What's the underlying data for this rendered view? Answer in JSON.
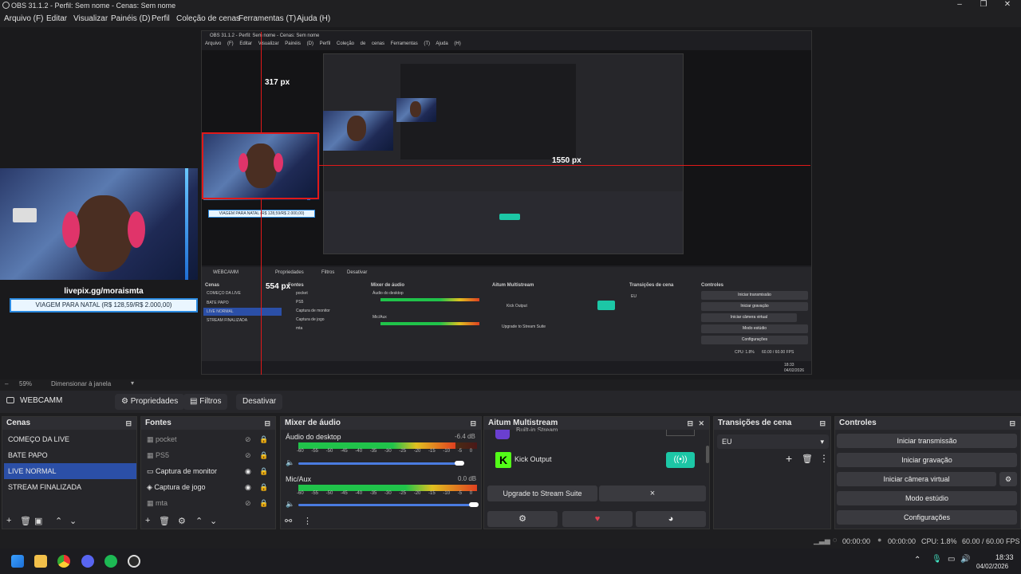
{
  "app": {
    "title": "OBS 31.1.2 - Perfil: Sem nome - Cenas: Sem nome"
  },
  "menu": [
    "Arquivo (F)",
    "Editar",
    "Visualizar",
    "Painéis (D)",
    "Perfil",
    "Coleção de cenas",
    "Ferramentas (T)",
    "Ajuda (H)"
  ],
  "preview": {
    "dim1": "317 px",
    "dim2": "554 px",
    "dim3": "1550 px",
    "overlay_url": "livepix.gg/moraismta",
    "overlay_goal": "VIAGEM PARA NATAL (R$ 128,59/R$ 2.000,00)",
    "zoom": "59%",
    "zoom_mode": "Dimensionar à janela"
  },
  "source_toolbar": {
    "source": "WEBCAMM",
    "properties": "Propriedades",
    "filters": "Filtros",
    "deactivate": "Desativar"
  },
  "scenes": {
    "title": "Cenas",
    "items": [
      "COMEÇO DA LIVE",
      "BATE PAPO",
      "LIVE NORMAL",
      "STREAM FINALIZADA"
    ],
    "selected": 2
  },
  "sources": {
    "title": "Fontes",
    "items": [
      {
        "name": "pocket",
        "visible": false
      },
      {
        "name": "PS5",
        "visible": false
      },
      {
        "name": "Captura de monitor",
        "visible": true
      },
      {
        "name": "Captura de jogo",
        "visible": true
      },
      {
        "name": "mta",
        "visible": false
      }
    ]
  },
  "mixer": {
    "title": "Mixer de áudio",
    "channels": [
      {
        "name": "Áudio do desktop",
        "db": "-6.4 dB",
        "level": 0.88,
        "volume": 0.92
      },
      {
        "name": "Mic/Aux",
        "db": "0.0 dB",
        "level": 1.0,
        "volume": 1.0
      }
    ],
    "scale": [
      "-60",
      "-55",
      "-50",
      "-45",
      "-40",
      "-35",
      "-30",
      "-25",
      "-20",
      "-15",
      "-10",
      "-5",
      "0"
    ]
  },
  "multistream": {
    "title": "Aitum Multistream",
    "partial": "Built-in Stream",
    "output": "Kick Output",
    "upgrade": "Upgrade to Stream Suite",
    "close": "×"
  },
  "transitions": {
    "title": "Transições de cena",
    "value": "EU"
  },
  "controls": {
    "title": "Controles",
    "buttons": [
      "Iniciar transmissão",
      "Iniciar gravação",
      "Iniciar câmera virtual",
      "Modo estúdio",
      "Configurações"
    ]
  },
  "status": {
    "time1": "00:00:00",
    "time2": "00:00:00",
    "cpu": "CPU: 1.8%",
    "fps": "60.00 / 60.00 FPS"
  },
  "taskbar": {
    "time": "18:33",
    "date": "04/02/2026"
  },
  "nested": {
    "title": "OBS 31.1.2 - Perfil: Sem nome - Cenas: Sem nome",
    "menu": [
      "Arquivo (F)",
      "Editar",
      "Visualizar",
      "Painéis (D)",
      "Perfil",
      "Coleção de cenas",
      "Ferramentas (T)",
      "Ajuda (H)"
    ],
    "cpu": "CPU: 1.8%",
    "fps": "60.00 / 60.00 FPS",
    "time": "18:33",
    "date": "04/02/2026"
  },
  "colors": {
    "accent": "#2b4fa7",
    "guide": "#e01919",
    "kick": "#53fc18"
  }
}
